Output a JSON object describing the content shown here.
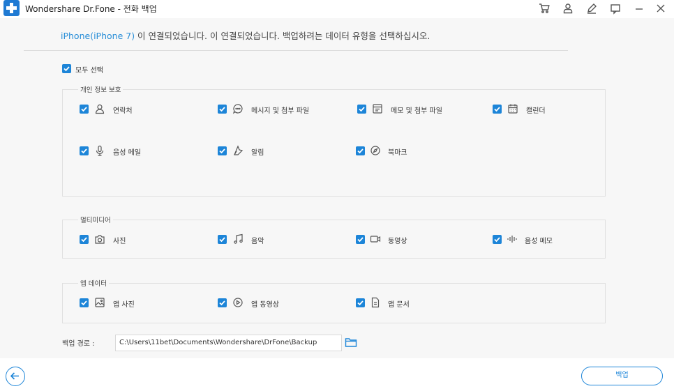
{
  "app": {
    "title": "Wondershare Dr.Fone - 전화 백업"
  },
  "header": {
    "device": "iPhone(iPhone 7)",
    "message": " 이 연결되었습니다. 이 연결되었습니다. 백업하려는 데이터 유형을 선택하십시오."
  },
  "select_all": {
    "label": "모두 선택",
    "checked": true
  },
  "groups": {
    "personal": {
      "title": "개인 정보 보호",
      "items": [
        {
          "label": "연락처",
          "icon": "contact-icon",
          "checked": true
        },
        {
          "label": "메시지 및 첨부 파일",
          "icon": "message-icon",
          "checked": true
        },
        {
          "label": "메모 및 첨부 파일",
          "icon": "note-icon",
          "checked": true
        },
        {
          "label": "캘린더",
          "icon": "calendar-icon",
          "checked": true
        },
        {
          "label": "음성 메일",
          "icon": "microphone-icon",
          "checked": true
        },
        {
          "label": "알림",
          "icon": "reminder-icon",
          "checked": true
        },
        {
          "label": "북마크",
          "icon": "compass-icon",
          "checked": true
        }
      ]
    },
    "multimedia": {
      "title": "멀티미디어",
      "items": [
        {
          "label": "사진",
          "icon": "camera-icon",
          "checked": true
        },
        {
          "label": "음악",
          "icon": "music-icon",
          "checked": true
        },
        {
          "label": "동영상",
          "icon": "video-icon",
          "checked": true
        },
        {
          "label": "음성 메모",
          "icon": "waveform-icon",
          "checked": true
        }
      ]
    },
    "app_data": {
      "title": "앱 데이터",
      "items": [
        {
          "label": "앱 사진",
          "icon": "image-icon",
          "checked": true
        },
        {
          "label": "앱 동영상",
          "icon": "play-icon",
          "checked": true
        },
        {
          "label": "앱 문서",
          "icon": "document-icon",
          "checked": true
        }
      ]
    }
  },
  "backup_path": {
    "label": "백업 경로 :",
    "value": "C:\\Users\\11bet\\Documents\\Wondershare\\DrFone\\Backup"
  },
  "footer": {
    "backup_label": "백업"
  },
  "colors": {
    "accent": "#1d85d8",
    "background": "#f7f7f7"
  }
}
